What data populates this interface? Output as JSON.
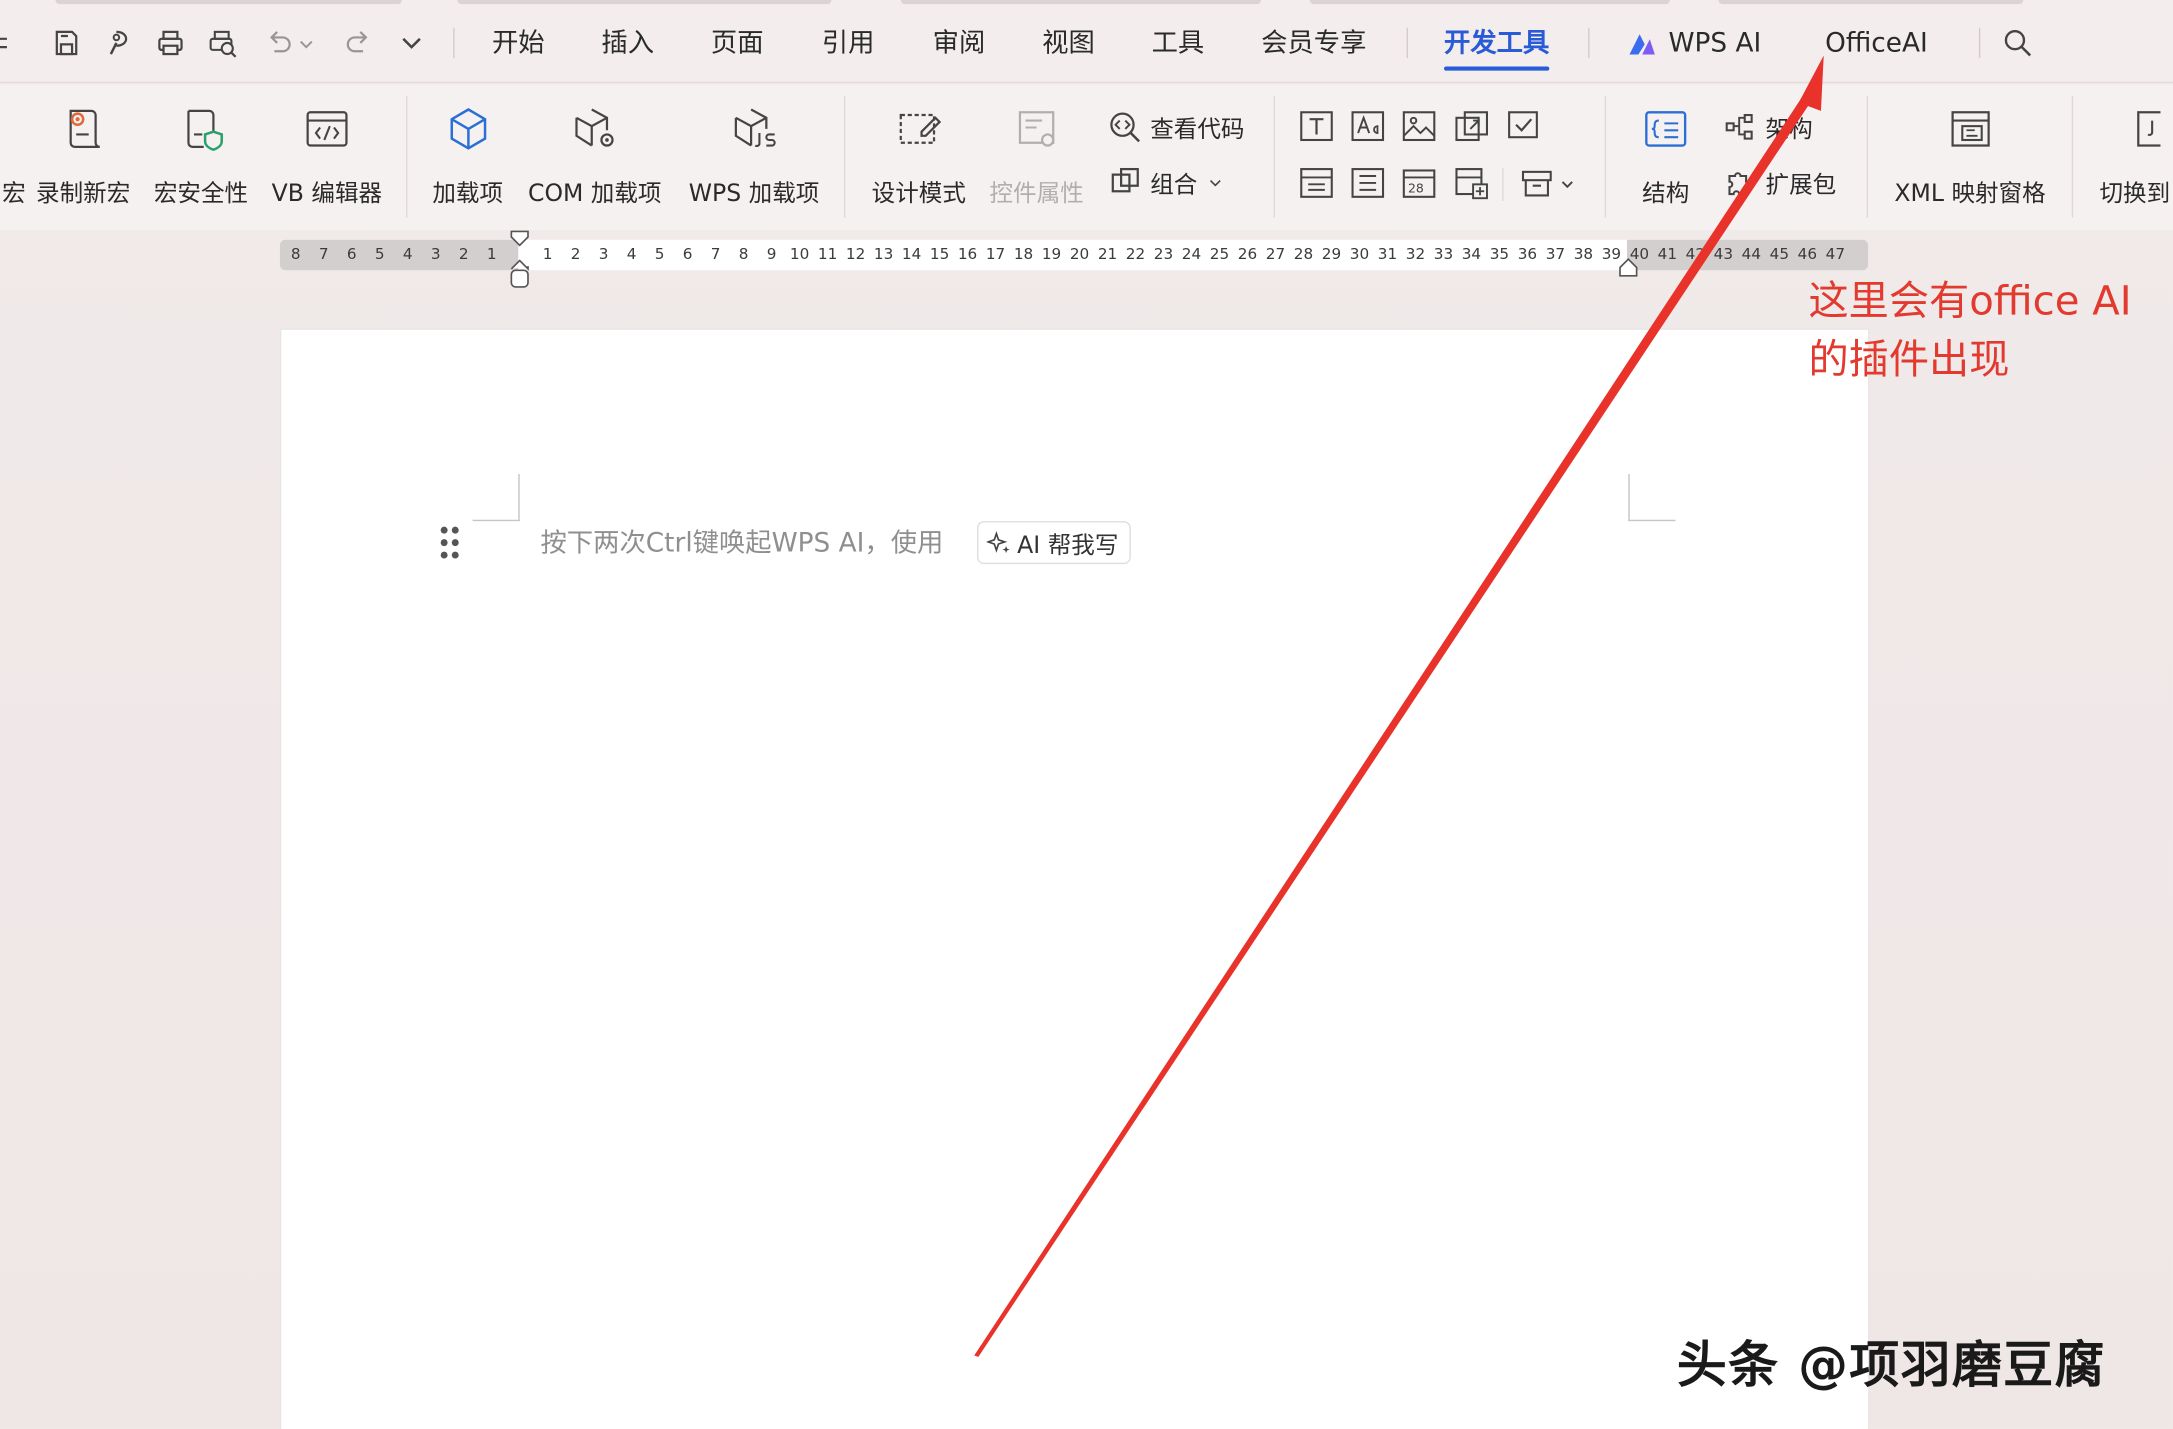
{
  "quick_access": {
    "icons": [
      "save-icon",
      "format-painter-icon",
      "print-icon",
      "print-preview-icon",
      "undo-icon",
      "redo-icon",
      "more-chevron-icon"
    ]
  },
  "menu": {
    "tabs": [
      {
        "label": "开始"
      },
      {
        "label": "插入"
      },
      {
        "label": "页面"
      },
      {
        "label": "引用"
      },
      {
        "label": "审阅"
      },
      {
        "label": "视图"
      },
      {
        "label": "工具"
      },
      {
        "label": "会员专享"
      },
      {
        "label": "开发工具",
        "active": true
      },
      {
        "label": "WPS AI"
      },
      {
        "label": "OfficeAI"
      }
    ],
    "accent_color": "#2a5bd7"
  },
  "ribbon": {
    "macro_partial": "宏",
    "record_macro": "录制新宏",
    "macro_security": "宏安全性",
    "vb_editor": "VB 编辑器",
    "addins": "加载项",
    "com_addins": "COM 加载项",
    "wps_addins": "WPS 加载项",
    "design_mode": "设计模式",
    "control_props": "控件属性",
    "view_code": "查看代码",
    "group": "组合",
    "structure": "结构",
    "schema": "架构",
    "expansion_pack": "扩展包",
    "xml_mapping": "XML 映射窗格",
    "switch_to": "切换到"
  },
  "ruler": {
    "left_numbers": [
      "8",
      "7",
      "6",
      "5",
      "4",
      "3",
      "2",
      "1"
    ],
    "right_numbers": [
      "1",
      "2",
      "3",
      "4",
      "5",
      "6",
      "7",
      "8",
      "9",
      "10",
      "11",
      "12",
      "13",
      "14",
      "15",
      "16",
      "17",
      "18",
      "19",
      "20",
      "21",
      "22",
      "23",
      "24",
      "25",
      "26",
      "27",
      "28",
      "29",
      "30",
      "31",
      "32",
      "33",
      "34",
      "35",
      "36",
      "37",
      "38",
      "39",
      "40",
      "41",
      "42",
      "43",
      "44",
      "45",
      "46",
      "47"
    ]
  },
  "document": {
    "placeholder": "按下两次Ctrl键唤起WPS AI，使用",
    "ai_chip_label": "AI 帮我写"
  },
  "annotation": {
    "line1": "这里会有office AI",
    "line2": "的插件出现",
    "color": "#e23a2f"
  },
  "watermark": "头条 @项羽磨豆腐"
}
